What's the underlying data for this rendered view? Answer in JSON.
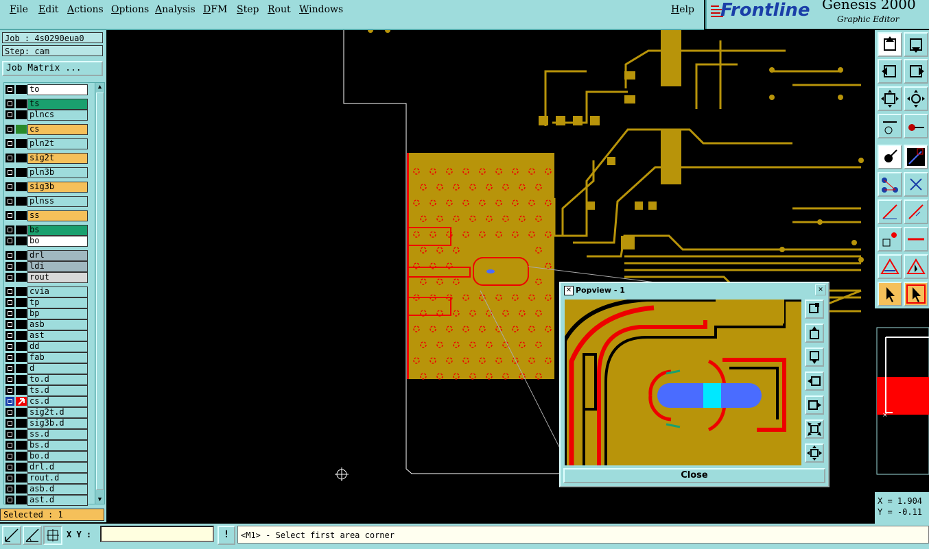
{
  "menu": [
    "File",
    "Edit",
    "Actions",
    "Options",
    "Analysis",
    "DFM",
    "Step",
    "Rout",
    "Windows"
  ],
  "help": "Help",
  "brand": {
    "name": "Frontline",
    "title": "Genesis 2000",
    "subtitle": "Graphic Editor"
  },
  "job_label": "Job : 4s0290eua0",
  "step_label": "Step: cam",
  "job_matrix": "Job Matrix ...",
  "layers": [
    {
      "name": "to",
      "color": "#ffffff"
    },
    {
      "name": "ts",
      "color": "#1aa06e"
    },
    {
      "name": "plncs",
      "color": "#9edcdc"
    },
    {
      "name": "cs",
      "color": "#f5c05a"
    },
    {
      "name": "pln2t",
      "color": "#9edcdc"
    },
    {
      "name": "sig2t",
      "color": "#f5c05a"
    },
    {
      "name": "pln3b",
      "color": "#9edcdc"
    },
    {
      "name": "sig3b",
      "color": "#f5c05a"
    },
    {
      "name": "plnss",
      "color": "#9edcdc"
    },
    {
      "name": "ss",
      "color": "#f5c05a"
    },
    {
      "name": "bs",
      "color": "#1aa06e"
    },
    {
      "name": "bo",
      "color": "#ffffff"
    },
    {
      "name": "drl",
      "color": "#a0b8c0"
    },
    {
      "name": "ldi",
      "color": "#a0b8c0"
    },
    {
      "name": "rout",
      "color": "#d8d8d8"
    },
    {
      "name": "cvia",
      "color": "#9edcdc"
    },
    {
      "name": "tp",
      "color": "#9edcdc"
    },
    {
      "name": "bp",
      "color": "#9edcdc"
    },
    {
      "name": "asb",
      "color": "#9edcdc"
    },
    {
      "name": "ast",
      "color": "#9edcdc"
    },
    {
      "name": "dd",
      "color": "#9edcdc"
    },
    {
      "name": "fab",
      "color": "#9edcdc"
    },
    {
      "name": "d",
      "color": "#9edcdc"
    },
    {
      "name": "to.d",
      "color": "#9edcdc"
    },
    {
      "name": "ts.d",
      "color": "#9edcdc"
    },
    {
      "name": "cs.d",
      "color": "#9edcdc"
    },
    {
      "name": "sig2t.d",
      "color": "#9edcdc"
    },
    {
      "name": "sig3b.d",
      "color": "#9edcdc"
    },
    {
      "name": "ss.d",
      "color": "#9edcdc"
    },
    {
      "name": "bs.d",
      "color": "#9edcdc"
    },
    {
      "name": "bo.d",
      "color": "#9edcdc"
    },
    {
      "name": "drl.d",
      "color": "#9edcdc"
    },
    {
      "name": "rout.d",
      "color": "#9edcdc"
    },
    {
      "name": "asb.d",
      "color": "#9edcdc"
    },
    {
      "name": "ast.d",
      "color": "#9edcdc"
    }
  ],
  "selected": "Selected : 1",
  "xy_label": "X Y :",
  "xy_value": "",
  "message": "<M1> - Select first area corner",
  "popview": {
    "title": "Popview - 1",
    "close": "Close"
  },
  "coords": {
    "x": "X = 1.904",
    "y": "Y = -0.11"
  },
  "colors": {
    "copper": "#b8940a",
    "panel": "#9edcdc",
    "highlight": "#f5c05a",
    "mask": "#ff0000",
    "pad_blue": "#4a6cff",
    "pad_cyan": "#00e8ff"
  }
}
